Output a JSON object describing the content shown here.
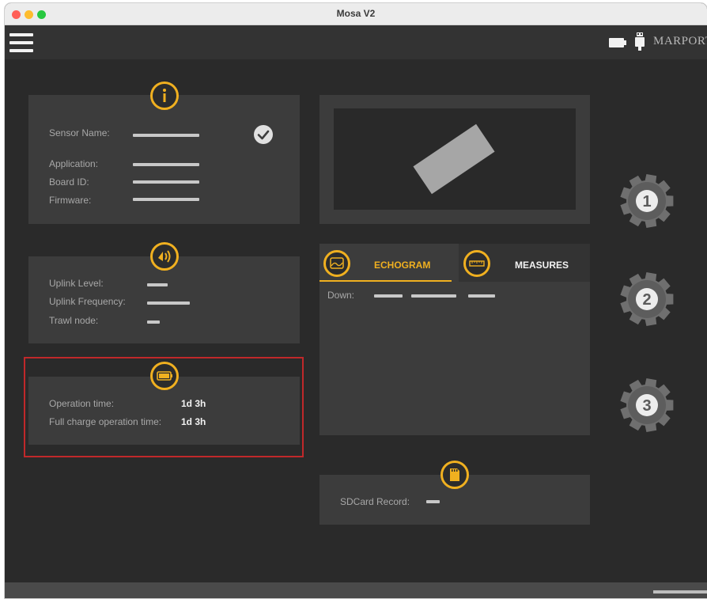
{
  "window": {
    "title": "Mosa V2"
  },
  "appbar": {
    "brand": "MARPORT",
    "menu_icon": "hamburger-menu-icon",
    "battery_icon": "battery-icon",
    "usb_icon": "usb-icon"
  },
  "colors": {
    "accent": "#f0b020",
    "background": "#2a2a2a",
    "card": "#3c3c3c",
    "highlight_border": "#c0282a"
  },
  "info_card": {
    "icon": "info-icon",
    "rows": [
      {
        "label": "Sensor Name:"
      },
      {
        "label": "Application:"
      },
      {
        "label": "Board ID:"
      },
      {
        "label": "Firmware:"
      }
    ],
    "status_icon": "check-circle-icon"
  },
  "uplink_card": {
    "icon": "uplink-sound-icon",
    "rows": [
      {
        "label": "Uplink Level:"
      },
      {
        "label": "Uplink Frequency:"
      },
      {
        "label": "Trawl node:"
      }
    ]
  },
  "battery_card": {
    "icon": "battery-icon",
    "rows": [
      {
        "label": "Operation time:",
        "value": "1d 3h"
      },
      {
        "label": "Full charge operation time:",
        "value": "1d 3h"
      }
    ]
  },
  "tabs": [
    {
      "label": "ECHOGRAM",
      "icon": "echogram-icon",
      "active": true
    },
    {
      "label": "MEASURES",
      "icon": "ruler-icon",
      "active": false
    }
  ],
  "echogram": {
    "down_label": "Down:"
  },
  "sdcard": {
    "icon": "sdcard-icon",
    "label": "SDCard Record:"
  },
  "gears": [
    {
      "number": "1",
      "icon": "gear-icon"
    },
    {
      "number": "2",
      "icon": "gear-icon"
    },
    {
      "number": "3",
      "icon": "gear-icon"
    }
  ]
}
